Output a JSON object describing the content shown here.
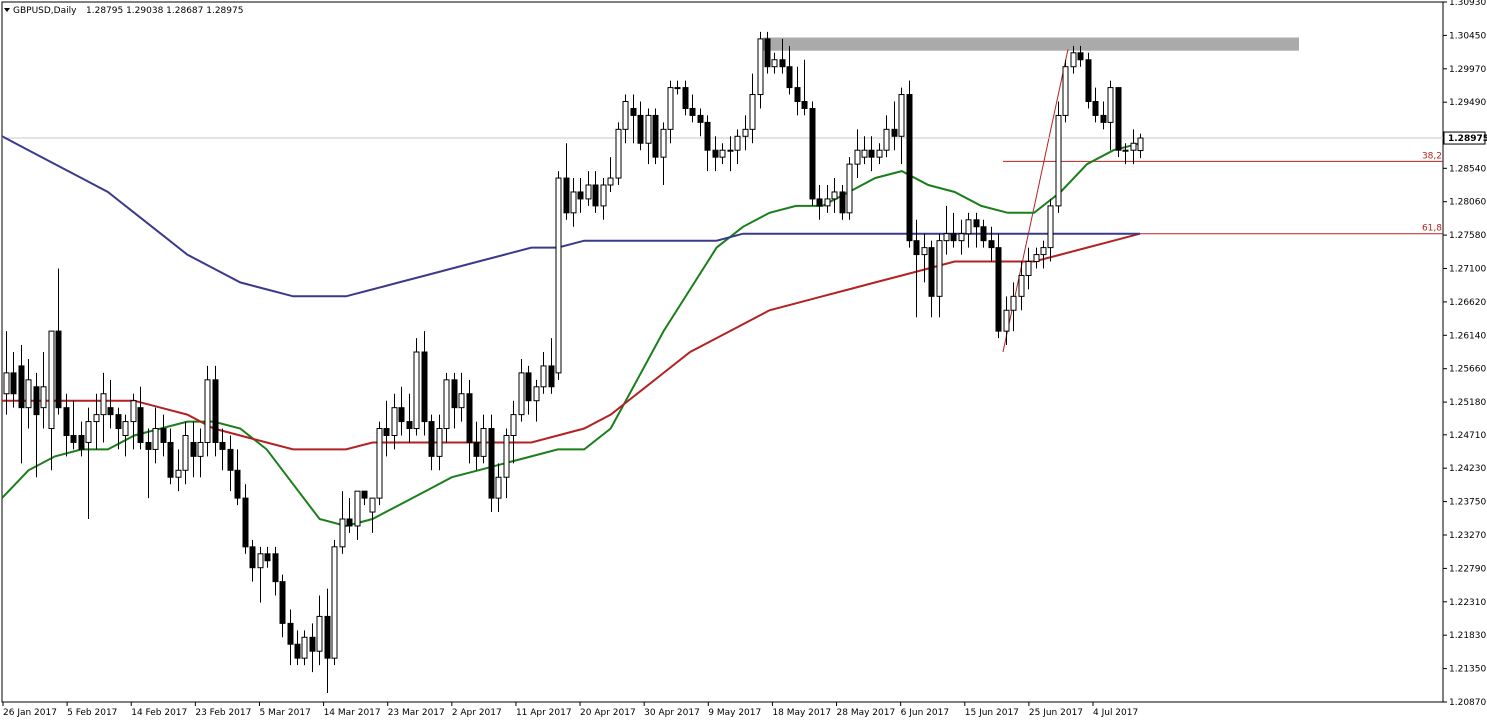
{
  "header": {
    "symbol": "GBPUSD,Daily",
    "quote": "1.28795 1.29038 1.28687 1.28975"
  },
  "chart_data": {
    "type": "candlestick",
    "symbol": "GBPUSD",
    "timeframe": "Daily",
    "ohlc_last": {
      "open": 1.28795,
      "high": 1.29038,
      "low": 1.28687,
      "close": 1.28975
    },
    "current_price": "1.28975",
    "ylim": [
      1.2087,
      1.3093
    ],
    "y_ticks": [
      "1.30930",
      "1.30450",
      "1.29970",
      "1.29490",
      "1.29010",
      "1.28540",
      "1.28060",
      "1.27580",
      "1.27100",
      "1.26620",
      "1.26140",
      "1.25660",
      "1.25180",
      "1.24710",
      "1.24230",
      "1.23750",
      "1.23270",
      "1.22790",
      "1.22310",
      "1.21830",
      "1.21350",
      "1.20870"
    ],
    "x_ticks": [
      "26 Jan 2017",
      "5 Feb 2017",
      "14 Feb 2017",
      "23 Feb 2017",
      "5 Mar 2017",
      "14 Mar 2017",
      "23 Mar 2017",
      "2 Apr 2017",
      "11 Apr 2017",
      "20 Apr 2017",
      "30 Apr 2017",
      "9 May 2017",
      "18 May 2017",
      "28 May 2017",
      "6 Jun 2017",
      "15 Jun 2017",
      "25 Jun 2017",
      "4 Jul 2017"
    ],
    "fibonacci": [
      {
        "label": "38,2",
        "price": 1.2864
      },
      {
        "label": "61,8",
        "price": 1.276
      }
    ],
    "fib_swing": {
      "low": 1.259,
      "high": 1.3025
    },
    "resistance_zone": {
      "from": 1.3023,
      "to": 1.3042
    },
    "candles": [
      {
        "o": 1.253,
        "h": 1.262,
        "l": 1.25,
        "c": 1.256
      },
      {
        "o": 1.256,
        "h": 1.259,
        "l": 1.251,
        "c": 1.253
      },
      {
        "o": 1.257,
        "h": 1.26,
        "l": 1.243,
        "c": 1.251
      },
      {
        "o": 1.251,
        "h": 1.258,
        "l": 1.248,
        "c": 1.255
      },
      {
        "o": 1.254,
        "h": 1.256,
        "l": 1.241,
        "c": 1.25
      },
      {
        "o": 1.251,
        "h": 1.259,
        "l": 1.248,
        "c": 1.254
      },
      {
        "o": 1.248,
        "h": 1.261,
        "l": 1.242,
        "c": 1.262
      },
      {
        "o": 1.262,
        "h": 1.271,
        "l": 1.25,
        "c": 1.251
      },
      {
        "o": 1.251,
        "h": 1.253,
        "l": 1.244,
        "c": 1.247
      },
      {
        "o": 1.247,
        "h": 1.252,
        "l": 1.245,
        "c": 1.246
      },
      {
        "o": 1.247,
        "h": 1.249,
        "l": 1.244,
        "c": 1.245
      },
      {
        "o": 1.246,
        "h": 1.251,
        "l": 1.235,
        "c": 1.249
      },
      {
        "o": 1.249,
        "h": 1.253,
        "l": 1.245,
        "c": 1.25
      },
      {
        "o": 1.25,
        "h": 1.256,
        "l": 1.246,
        "c": 1.253
      },
      {
        "o": 1.251,
        "h": 1.255,
        "l": 1.248,
        "c": 1.25
      },
      {
        "o": 1.25,
        "h": 1.251,
        "l": 1.245,
        "c": 1.248
      },
      {
        "o": 1.247,
        "h": 1.25,
        "l": 1.244,
        "c": 1.249
      },
      {
        "o": 1.249,
        "h": 1.253,
        "l": 1.245,
        "c": 1.252
      },
      {
        "o": 1.251,
        "h": 1.254,
        "l": 1.245,
        "c": 1.246
      },
      {
        "o": 1.246,
        "h": 1.248,
        "l": 1.238,
        "c": 1.245
      },
      {
        "o": 1.245,
        "h": 1.251,
        "l": 1.243,
        "c": 1.248
      },
      {
        "o": 1.248,
        "h": 1.25,
        "l": 1.244,
        "c": 1.246
      },
      {
        "o": 1.246,
        "h": 1.248,
        "l": 1.24,
        "c": 1.241
      },
      {
        "o": 1.241,
        "h": 1.245,
        "l": 1.239,
        "c": 1.242
      },
      {
        "o": 1.242,
        "h": 1.249,
        "l": 1.24,
        "c": 1.247
      },
      {
        "o": 1.246,
        "h": 1.249,
        "l": 1.241,
        "c": 1.244
      },
      {
        "o": 1.244,
        "h": 1.248,
        "l": 1.241,
        "c": 1.246
      },
      {
        "o": 1.246,
        "h": 1.257,
        "l": 1.244,
        "c": 1.255
      },
      {
        "o": 1.255,
        "h": 1.257,
        "l": 1.244,
        "c": 1.246
      },
      {
        "o": 1.246,
        "h": 1.248,
        "l": 1.242,
        "c": 1.245
      },
      {
        "o": 1.245,
        "h": 1.247,
        "l": 1.239,
        "c": 1.242
      },
      {
        "o": 1.242,
        "h": 1.245,
        "l": 1.237,
        "c": 1.238
      },
      {
        "o": 1.238,
        "h": 1.24,
        "l": 1.23,
        "c": 1.231
      },
      {
        "o": 1.231,
        "h": 1.232,
        "l": 1.226,
        "c": 1.228
      },
      {
        "o": 1.228,
        "h": 1.231,
        "l": 1.223,
        "c": 1.23
      },
      {
        "o": 1.23,
        "h": 1.231,
        "l": 1.228,
        "c": 1.229
      },
      {
        "o": 1.23,
        "h": 1.231,
        "l": 1.224,
        "c": 1.226
      },
      {
        "o": 1.226,
        "h": 1.227,
        "l": 1.218,
        "c": 1.22
      },
      {
        "o": 1.22,
        "h": 1.222,
        "l": 1.214,
        "c": 1.217
      },
      {
        "o": 1.217,
        "h": 1.219,
        "l": 1.214,
        "c": 1.215
      },
      {
        "o": 1.215,
        "h": 1.219,
        "l": 1.214,
        "c": 1.218
      },
      {
        "o": 1.218,
        "h": 1.22,
        "l": 1.213,
        "c": 1.216
      },
      {
        "o": 1.216,
        "h": 1.224,
        "l": 1.214,
        "c": 1.221
      },
      {
        "o": 1.221,
        "h": 1.225,
        "l": 1.21,
        "c": 1.215
      },
      {
        "o": 1.215,
        "h": 1.232,
        "l": 1.214,
        "c": 1.231
      },
      {
        "o": 1.231,
        "h": 1.239,
        "l": 1.23,
        "c": 1.235
      },
      {
        "o": 1.235,
        "h": 1.238,
        "l": 1.233,
        "c": 1.234
      },
      {
        "o": 1.234,
        "h": 1.239,
        "l": 1.232,
        "c": 1.239
      },
      {
        "o": 1.239,
        "h": 1.239,
        "l": 1.237,
        "c": 1.238
      },
      {
        "o": 1.236,
        "h": 1.238,
        "l": 1.233,
        "c": 1.238
      },
      {
        "o": 1.238,
        "h": 1.249,
        "l": 1.237,
        "c": 1.248
      },
      {
        "o": 1.248,
        "h": 1.252,
        "l": 1.244,
        "c": 1.247
      },
      {
        "o": 1.247,
        "h": 1.253,
        "l": 1.245,
        "c": 1.251
      },
      {
        "o": 1.251,
        "h": 1.254,
        "l": 1.247,
        "c": 1.249
      },
      {
        "o": 1.249,
        "h": 1.253,
        "l": 1.246,
        "c": 1.248
      },
      {
        "o": 1.248,
        "h": 1.261,
        "l": 1.247,
        "c": 1.259
      },
      {
        "o": 1.259,
        "h": 1.262,
        "l": 1.247,
        "c": 1.249
      },
      {
        "o": 1.249,
        "h": 1.25,
        "l": 1.242,
        "c": 1.244
      },
      {
        "o": 1.244,
        "h": 1.25,
        "l": 1.242,
        "c": 1.248
      },
      {
        "o": 1.248,
        "h": 1.256,
        "l": 1.246,
        "c": 1.255
      },
      {
        "o": 1.255,
        "h": 1.256,
        "l": 1.248,
        "c": 1.251
      },
      {
        "o": 1.251,
        "h": 1.256,
        "l": 1.249,
        "c": 1.253
      },
      {
        "o": 1.253,
        "h": 1.255,
        "l": 1.243,
        "c": 1.246
      },
      {
        "o": 1.246,
        "h": 1.249,
        "l": 1.242,
        "c": 1.244
      },
      {
        "o": 1.244,
        "h": 1.25,
        "l": 1.243,
        "c": 1.248
      },
      {
        "o": 1.248,
        "h": 1.25,
        "l": 1.236,
        "c": 1.238
      },
      {
        "o": 1.238,
        "h": 1.243,
        "l": 1.236,
        "c": 1.241
      },
      {
        "o": 1.241,
        "h": 1.248,
        "l": 1.238,
        "c": 1.247
      },
      {
        "o": 1.247,
        "h": 1.252,
        "l": 1.243,
        "c": 1.25
      },
      {
        "o": 1.25,
        "h": 1.258,
        "l": 1.249,
        "c": 1.256
      },
      {
        "o": 1.256,
        "h": 1.257,
        "l": 1.25,
        "c": 1.252
      },
      {
        "o": 1.252,
        "h": 1.255,
        "l": 1.249,
        "c": 1.254
      },
      {
        "o": 1.254,
        "h": 1.259,
        "l": 1.253,
        "c": 1.257
      },
      {
        "o": 1.257,
        "h": 1.261,
        "l": 1.253,
        "c": 1.254
      },
      {
        "o": 1.256,
        "h": 1.285,
        "l": 1.255,
        "c": 1.284
      },
      {
        "o": 1.284,
        "h": 1.289,
        "l": 1.278,
        "c": 1.279
      },
      {
        "o": 1.279,
        "h": 1.284,
        "l": 1.277,
        "c": 1.282
      },
      {
        "o": 1.282,
        "h": 1.284,
        "l": 1.279,
        "c": 1.281
      },
      {
        "o": 1.281,
        "h": 1.285,
        "l": 1.28,
        "c": 1.283
      },
      {
        "o": 1.283,
        "h": 1.285,
        "l": 1.279,
        "c": 1.28
      },
      {
        "o": 1.28,
        "h": 1.284,
        "l": 1.278,
        "c": 1.283
      },
      {
        "o": 1.283,
        "h": 1.287,
        "l": 1.282,
        "c": 1.284
      },
      {
        "o": 1.284,
        "h": 1.292,
        "l": 1.283,
        "c": 1.291
      },
      {
        "o": 1.291,
        "h": 1.296,
        "l": 1.289,
        "c": 1.295
      },
      {
        "o": 1.294,
        "h": 1.296,
        "l": 1.289,
        "c": 1.293
      },
      {
        "o": 1.293,
        "h": 1.295,
        "l": 1.288,
        "c": 1.289
      },
      {
        "o": 1.289,
        "h": 1.294,
        "l": 1.286,
        "c": 1.293
      },
      {
        "o": 1.293,
        "h": 1.294,
        "l": 1.286,
        "c": 1.287
      },
      {
        "o": 1.287,
        "h": 1.292,
        "l": 1.283,
        "c": 1.291
      },
      {
        "o": 1.291,
        "h": 1.298,
        "l": 1.289,
        "c": 1.297
      },
      {
        "o": 1.297,
        "h": 1.298,
        "l": 1.296,
        "c": 1.297
      },
      {
        "o": 1.297,
        "h": 1.298,
        "l": 1.293,
        "c": 1.294
      },
      {
        "o": 1.294,
        "h": 1.296,
        "l": 1.292,
        "c": 1.293
      },
      {
        "o": 1.293,
        "h": 1.294,
        "l": 1.29,
        "c": 1.292
      },
      {
        "o": 1.292,
        "h": 1.293,
        "l": 1.285,
        "c": 1.288
      },
      {
        "o": 1.288,
        "h": 1.29,
        "l": 1.285,
        "c": 1.287
      },
      {
        "o": 1.287,
        "h": 1.289,
        "l": 1.286,
        "c": 1.288
      },
      {
        "o": 1.288,
        "h": 1.29,
        "l": 1.285,
        "c": 1.288
      },
      {
        "o": 1.288,
        "h": 1.291,
        "l": 1.286,
        "c": 1.29
      },
      {
        "o": 1.29,
        "h": 1.293,
        "l": 1.288,
        "c": 1.291
      },
      {
        "o": 1.291,
        "h": 1.299,
        "l": 1.289,
        "c": 1.296
      },
      {
        "o": 1.296,
        "h": 1.305,
        "l": 1.294,
        "c": 1.304
      },
      {
        "o": 1.304,
        "h": 1.305,
        "l": 1.299,
        "c": 1.3
      },
      {
        "o": 1.3,
        "h": 1.302,
        "l": 1.299,
        "c": 1.301
      },
      {
        "o": 1.301,
        "h": 1.304,
        "l": 1.299,
        "c": 1.3
      },
      {
        "o": 1.3,
        "h": 1.303,
        "l": 1.296,
        "c": 1.297
      },
      {
        "o": 1.297,
        "h": 1.3,
        "l": 1.293,
        "c": 1.295
      },
      {
        "o": 1.295,
        "h": 1.301,
        "l": 1.293,
        "c": 1.294
      },
      {
        "o": 1.294,
        "h": 1.295,
        "l": 1.28,
        "c": 1.281
      },
      {
        "o": 1.281,
        "h": 1.283,
        "l": 1.278,
        "c": 1.28
      },
      {
        "o": 1.28,
        "h": 1.283,
        "l": 1.279,
        "c": 1.281
      },
      {
        "o": 1.281,
        "h": 1.284,
        "l": 1.279,
        "c": 1.282
      },
      {
        "o": 1.282,
        "h": 1.283,
        "l": 1.278,
        "c": 1.279
      },
      {
        "o": 1.279,
        "h": 1.287,
        "l": 1.278,
        "c": 1.286
      },
      {
        "o": 1.286,
        "h": 1.291,
        "l": 1.284,
        "c": 1.288
      },
      {
        "o": 1.287,
        "h": 1.29,
        "l": 1.286,
        "c": 1.288
      },
      {
        "o": 1.288,
        "h": 1.29,
        "l": 1.285,
        "c": 1.287
      },
      {
        "o": 1.287,
        "h": 1.289,
        "l": 1.286,
        "c": 1.288
      },
      {
        "o": 1.288,
        "h": 1.293,
        "l": 1.287,
        "c": 1.291
      },
      {
        "o": 1.291,
        "h": 1.295,
        "l": 1.288,
        "c": 1.29
      },
      {
        "o": 1.29,
        "h": 1.297,
        "l": 1.286,
        "c": 1.296
      },
      {
        "o": 1.296,
        "h": 1.298,
        "l": 1.274,
        "c": 1.275
      },
      {
        "o": 1.275,
        "h": 1.278,
        "l": 1.264,
        "c": 1.273
      },
      {
        "o": 1.273,
        "h": 1.276,
        "l": 1.269,
        "c": 1.274
      },
      {
        "o": 1.274,
        "h": 1.275,
        "l": 1.264,
        "c": 1.267
      },
      {
        "o": 1.267,
        "h": 1.276,
        "l": 1.264,
        "c": 1.275
      },
      {
        "o": 1.275,
        "h": 1.28,
        "l": 1.273,
        "c": 1.276
      },
      {
        "o": 1.276,
        "h": 1.279,
        "l": 1.274,
        "c": 1.275
      },
      {
        "o": 1.275,
        "h": 1.278,
        "l": 1.273,
        "c": 1.276
      },
      {
        "o": 1.276,
        "h": 1.279,
        "l": 1.274,
        "c": 1.278
      },
      {
        "o": 1.278,
        "h": 1.279,
        "l": 1.274,
        "c": 1.277
      },
      {
        "o": 1.277,
        "h": 1.278,
        "l": 1.274,
        "c": 1.275
      },
      {
        "o": 1.275,
        "h": 1.277,
        "l": 1.272,
        "c": 1.274
      },
      {
        "o": 1.274,
        "h": 1.276,
        "l": 1.261,
        "c": 1.262
      },
      {
        "o": 1.262,
        "h": 1.267,
        "l": 1.26,
        "c": 1.265
      },
      {
        "o": 1.265,
        "h": 1.269,
        "l": 1.262,
        "c": 1.267
      },
      {
        "o": 1.267,
        "h": 1.272,
        "l": 1.265,
        "c": 1.27
      },
      {
        "o": 1.27,
        "h": 1.274,
        "l": 1.268,
        "c": 1.272
      },
      {
        "o": 1.272,
        "h": 1.274,
        "l": 1.271,
        "c": 1.273
      },
      {
        "o": 1.273,
        "h": 1.275,
        "l": 1.271,
        "c": 1.274
      },
      {
        "o": 1.274,
        "h": 1.281,
        "l": 1.272,
        "c": 1.28
      },
      {
        "o": 1.28,
        "h": 1.295,
        "l": 1.279,
        "c": 1.293
      },
      {
        "o": 1.293,
        "h": 1.301,
        "l": 1.292,
        "c": 1.3
      },
      {
        "o": 1.3,
        "h": 1.303,
        "l": 1.299,
        "c": 1.302
      },
      {
        "o": 1.302,
        "h": 1.303,
        "l": 1.3,
        "c": 1.301
      },
      {
        "o": 1.301,
        "h": 1.302,
        "l": 1.294,
        "c": 1.295
      },
      {
        "o": 1.295,
        "h": 1.297,
        "l": 1.292,
        "c": 1.293
      },
      {
        "o": 1.293,
        "h": 1.295,
        "l": 1.291,
        "c": 1.292
      },
      {
        "o": 1.292,
        "h": 1.298,
        "l": 1.288,
        "c": 1.297
      },
      {
        "o": 1.297,
        "h": 1.297,
        "l": 1.287,
        "c": 1.288
      },
      {
        "o": 1.288,
        "h": 1.289,
        "l": 1.286,
        "c": 1.288
      },
      {
        "o": 1.288,
        "h": 1.291,
        "l": 1.286,
        "c": 1.289
      },
      {
        "o": 1.28795,
        "h": 1.29038,
        "l": 1.28687,
        "c": 1.28975
      }
    ],
    "series": [
      {
        "color": "#1a7f1a",
        "values": [
          1.238,
          1.242,
          1.244,
          1.245,
          1.245,
          1.247,
          1.248,
          1.249,
          1.249,
          1.248,
          1.245,
          1.24,
          1.235,
          1.234,
          1.235,
          1.237,
          1.239,
          1.241,
          1.242,
          1.243,
          1.244,
          1.245,
          1.245,
          1.248,
          1.255,
          1.262,
          1.268,
          1.274,
          1.277,
          1.279,
          1.28,
          1.28,
          1.282,
          1.284,
          1.285,
          1.283,
          1.282,
          1.28,
          1.279,
          1.279,
          1.282,
          1.286,
          1.288,
          1.289
        ]
      },
      {
        "color": "#b22222",
        "values": [
          1.252,
          1.252,
          1.252,
          1.252,
          1.252,
          1.252,
          1.251,
          1.25,
          1.248,
          1.247,
          1.246,
          1.245,
          1.245,
          1.245,
          1.246,
          1.246,
          1.246,
          1.246,
          1.246,
          1.246,
          1.246,
          1.247,
          1.248,
          1.25,
          1.253,
          1.256,
          1.259,
          1.261,
          1.263,
          1.265,
          1.266,
          1.267,
          1.268,
          1.269,
          1.27,
          1.271,
          1.272,
          1.272,
          1.272,
          1.272,
          1.273,
          1.274,
          1.275,
          1.276
        ]
      },
      {
        "color": "#3a3a8c",
        "values": [
          1.29,
          1.288,
          1.286,
          1.284,
          1.282,
          1.279,
          1.276,
          1.273,
          1.271,
          1.269,
          1.268,
          1.267,
          1.267,
          1.267,
          1.268,
          1.269,
          1.27,
          1.271,
          1.272,
          1.273,
          1.274,
          1.274,
          1.275,
          1.275,
          1.275,
          1.275,
          1.275,
          1.275,
          1.276,
          1.276,
          1.276,
          1.276,
          1.276,
          1.276,
          1.276,
          1.276,
          1.276,
          1.276,
          1.276,
          1.276,
          1.276,
          1.276,
          1.276,
          1.276
        ]
      }
    ]
  }
}
